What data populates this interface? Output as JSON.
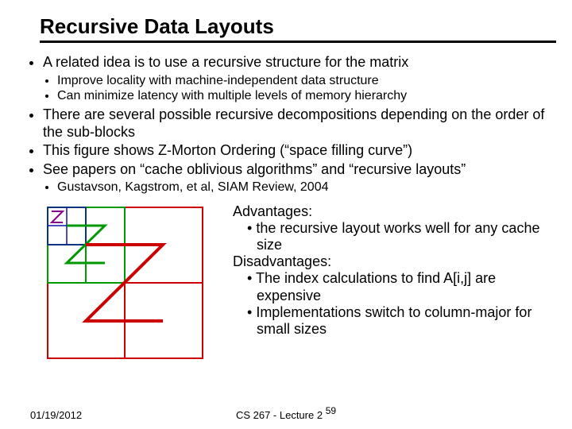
{
  "title": "Recursive Data Layouts",
  "bullets": {
    "b1": "A related idea is to use a recursive structure for the matrix",
    "b1a": "Improve locality with machine-independent data structure",
    "b1b": "Can minimize latency with multiple levels of memory hierarchy",
    "b2": "There are several possible recursive decompositions depending on the order of the sub-blocks",
    "b3": "This figure shows Z-Morton Ordering (“space filling curve”)",
    "b4": "See papers on “cache oblivious algorithms” and “recursive layouts”",
    "b4a": "Gustavson, Kagstrom, et al, SIAM Review, 2004"
  },
  "advantages": {
    "heading_adv": "Advantages:",
    "a1": "the recursive layout works well for any cache size",
    "heading_dis": "Disadvantages:",
    "d1": "The index calculations to find A[i,j] are expensive",
    "d2": "Implementations switch to column-major for small sizes"
  },
  "footer": {
    "date": "01/19/2012",
    "mid": "CS 267 - Lecture 2",
    "page": "59"
  }
}
